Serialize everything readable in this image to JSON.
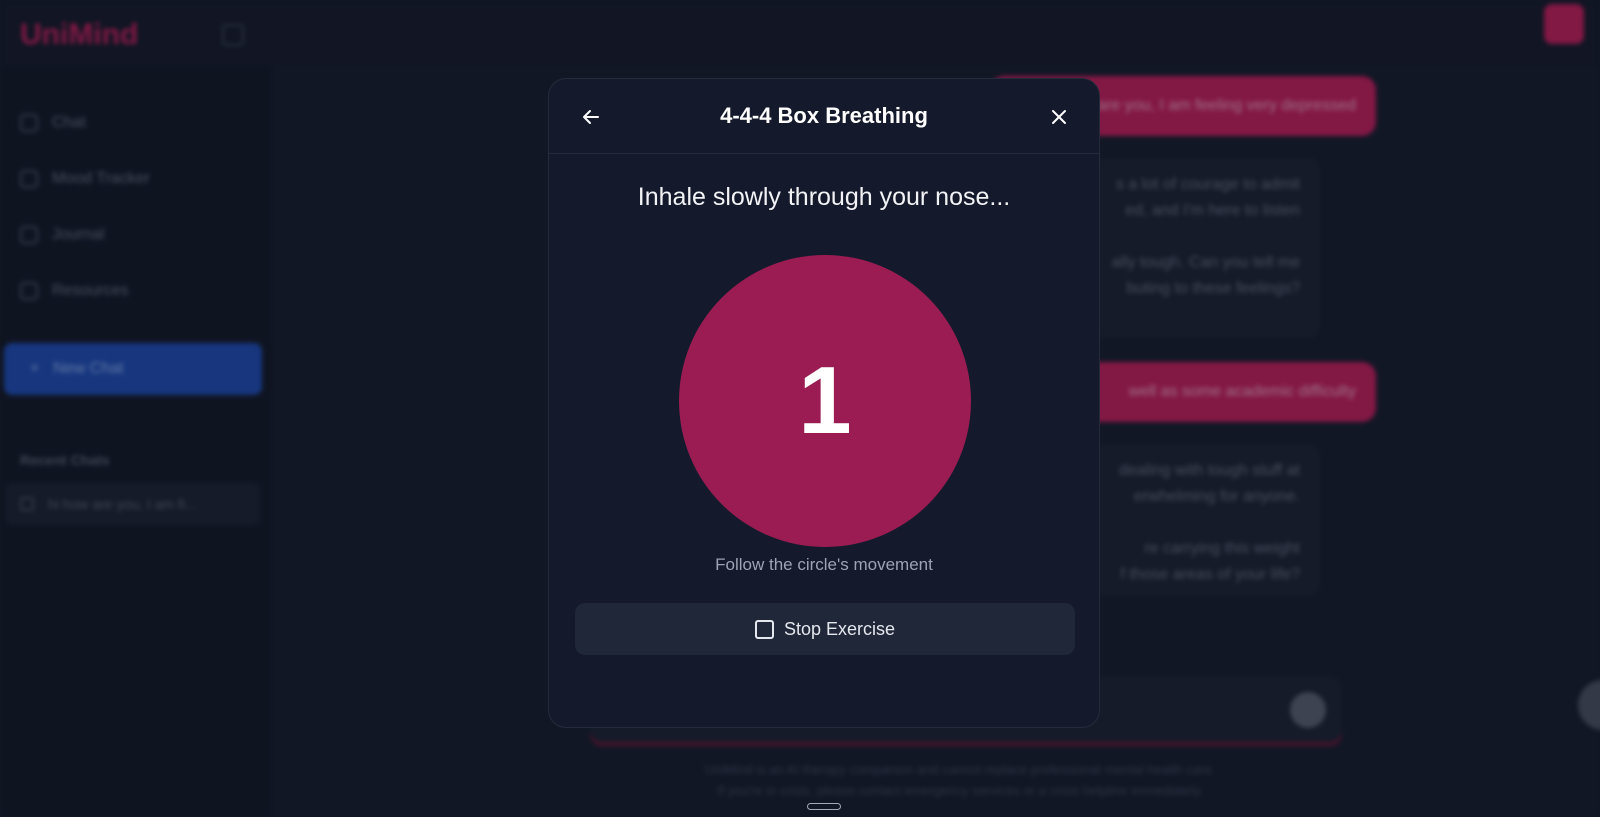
{
  "app": {
    "logo": "UniMind"
  },
  "sidebar": {
    "items": [
      {
        "label": "Chat",
        "icon": "chat-icon"
      },
      {
        "label": "Mood Tracker",
        "icon": "mood-icon"
      },
      {
        "label": "Journal",
        "icon": "journal-icon"
      },
      {
        "label": "Resources",
        "icon": "resources-icon"
      }
    ],
    "new_chat_label": "New Chat",
    "recent_title": "Recent Chats",
    "recent_items": [
      "hi how are you, I am fi..."
    ]
  },
  "chat": {
    "user_messages": [
      "ow are you, I am feeling very depressed",
      "well as some academic difficulty"
    ],
    "bot_messages": [
      [
        "s a lot of courage to admit",
        "ed, and I'm here to listen",
        "",
        "ally tough. Can you tell me",
        "buting to these feelings?"
      ],
      [
        "dealing with tough stuff at",
        "erwhelming for anyone.",
        "",
        "re carrying this weight",
        "f those areas of your life?"
      ]
    ]
  },
  "disclaimer": [
    "UniMind is an AI therapy companion and cannot replace professional mental health care.",
    "If you're in crisis, please contact emergency services or a crisis helpline immediately."
  ],
  "modal": {
    "title": "4-4-4 Box Breathing",
    "instruction": "Inhale slowly through your nose...",
    "count": "1",
    "hint": "Follow the circle's movement",
    "stop_label": "Stop Exercise"
  },
  "colors": {
    "accent": "#c41e5d",
    "circle": "#9b1c53",
    "primary": "#1f4cb6",
    "background": "#161b2c"
  }
}
